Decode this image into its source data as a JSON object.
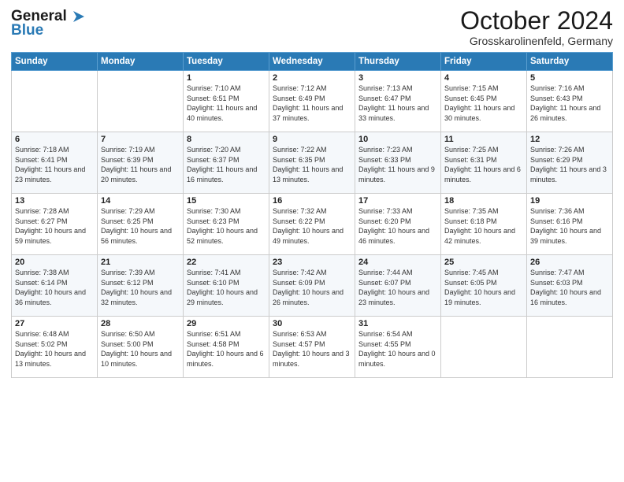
{
  "header": {
    "logo_line1": "General",
    "logo_line2": "Blue",
    "title": "October 2024",
    "location": "Grosskarolinenfeld, Germany"
  },
  "days_of_week": [
    "Sunday",
    "Monday",
    "Tuesday",
    "Wednesday",
    "Thursday",
    "Friday",
    "Saturday"
  ],
  "weeks": [
    [
      {
        "day": "",
        "info": ""
      },
      {
        "day": "",
        "info": ""
      },
      {
        "day": "1",
        "info": "Sunrise: 7:10 AM\nSunset: 6:51 PM\nDaylight: 11 hours and 40 minutes."
      },
      {
        "day": "2",
        "info": "Sunrise: 7:12 AM\nSunset: 6:49 PM\nDaylight: 11 hours and 37 minutes."
      },
      {
        "day": "3",
        "info": "Sunrise: 7:13 AM\nSunset: 6:47 PM\nDaylight: 11 hours and 33 minutes."
      },
      {
        "day": "4",
        "info": "Sunrise: 7:15 AM\nSunset: 6:45 PM\nDaylight: 11 hours and 30 minutes."
      },
      {
        "day": "5",
        "info": "Sunrise: 7:16 AM\nSunset: 6:43 PM\nDaylight: 11 hours and 26 minutes."
      }
    ],
    [
      {
        "day": "6",
        "info": "Sunrise: 7:18 AM\nSunset: 6:41 PM\nDaylight: 11 hours and 23 minutes."
      },
      {
        "day": "7",
        "info": "Sunrise: 7:19 AM\nSunset: 6:39 PM\nDaylight: 11 hours and 20 minutes."
      },
      {
        "day": "8",
        "info": "Sunrise: 7:20 AM\nSunset: 6:37 PM\nDaylight: 11 hours and 16 minutes."
      },
      {
        "day": "9",
        "info": "Sunrise: 7:22 AM\nSunset: 6:35 PM\nDaylight: 11 hours and 13 minutes."
      },
      {
        "day": "10",
        "info": "Sunrise: 7:23 AM\nSunset: 6:33 PM\nDaylight: 11 hours and 9 minutes."
      },
      {
        "day": "11",
        "info": "Sunrise: 7:25 AM\nSunset: 6:31 PM\nDaylight: 11 hours and 6 minutes."
      },
      {
        "day": "12",
        "info": "Sunrise: 7:26 AM\nSunset: 6:29 PM\nDaylight: 11 hours and 3 minutes."
      }
    ],
    [
      {
        "day": "13",
        "info": "Sunrise: 7:28 AM\nSunset: 6:27 PM\nDaylight: 10 hours and 59 minutes."
      },
      {
        "day": "14",
        "info": "Sunrise: 7:29 AM\nSunset: 6:25 PM\nDaylight: 10 hours and 56 minutes."
      },
      {
        "day": "15",
        "info": "Sunrise: 7:30 AM\nSunset: 6:23 PM\nDaylight: 10 hours and 52 minutes."
      },
      {
        "day": "16",
        "info": "Sunrise: 7:32 AM\nSunset: 6:22 PM\nDaylight: 10 hours and 49 minutes."
      },
      {
        "day": "17",
        "info": "Sunrise: 7:33 AM\nSunset: 6:20 PM\nDaylight: 10 hours and 46 minutes."
      },
      {
        "day": "18",
        "info": "Sunrise: 7:35 AM\nSunset: 6:18 PM\nDaylight: 10 hours and 42 minutes."
      },
      {
        "day": "19",
        "info": "Sunrise: 7:36 AM\nSunset: 6:16 PM\nDaylight: 10 hours and 39 minutes."
      }
    ],
    [
      {
        "day": "20",
        "info": "Sunrise: 7:38 AM\nSunset: 6:14 PM\nDaylight: 10 hours and 36 minutes."
      },
      {
        "day": "21",
        "info": "Sunrise: 7:39 AM\nSunset: 6:12 PM\nDaylight: 10 hours and 32 minutes."
      },
      {
        "day": "22",
        "info": "Sunrise: 7:41 AM\nSunset: 6:10 PM\nDaylight: 10 hours and 29 minutes."
      },
      {
        "day": "23",
        "info": "Sunrise: 7:42 AM\nSunset: 6:09 PM\nDaylight: 10 hours and 26 minutes."
      },
      {
        "day": "24",
        "info": "Sunrise: 7:44 AM\nSunset: 6:07 PM\nDaylight: 10 hours and 23 minutes."
      },
      {
        "day": "25",
        "info": "Sunrise: 7:45 AM\nSunset: 6:05 PM\nDaylight: 10 hours and 19 minutes."
      },
      {
        "day": "26",
        "info": "Sunrise: 7:47 AM\nSunset: 6:03 PM\nDaylight: 10 hours and 16 minutes."
      }
    ],
    [
      {
        "day": "27",
        "info": "Sunrise: 6:48 AM\nSunset: 5:02 PM\nDaylight: 10 hours and 13 minutes."
      },
      {
        "day": "28",
        "info": "Sunrise: 6:50 AM\nSunset: 5:00 PM\nDaylight: 10 hours and 10 minutes."
      },
      {
        "day": "29",
        "info": "Sunrise: 6:51 AM\nSunset: 4:58 PM\nDaylight: 10 hours and 6 minutes."
      },
      {
        "day": "30",
        "info": "Sunrise: 6:53 AM\nSunset: 4:57 PM\nDaylight: 10 hours and 3 minutes."
      },
      {
        "day": "31",
        "info": "Sunrise: 6:54 AM\nSunset: 4:55 PM\nDaylight: 10 hours and 0 minutes."
      },
      {
        "day": "",
        "info": ""
      },
      {
        "day": "",
        "info": ""
      }
    ]
  ]
}
